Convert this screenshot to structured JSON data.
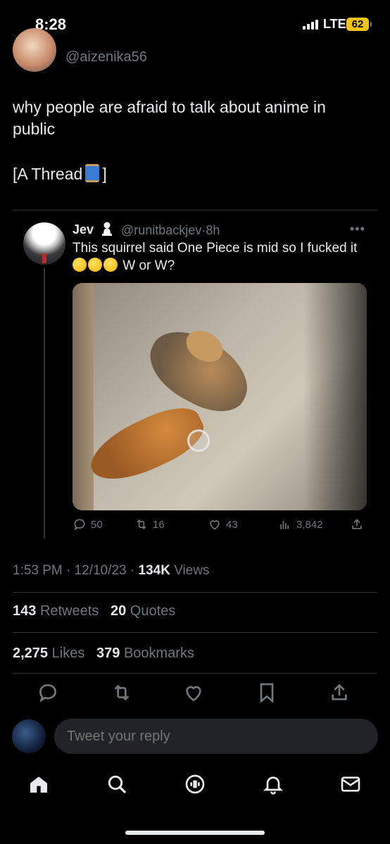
{
  "status_bar": {
    "time": "8:28",
    "network": "LTE",
    "battery": "62",
    "battery_color": "#f2c318"
  },
  "tweet": {
    "author_handle": "@aizenika56",
    "text_line1": "why people are afraid to talk about anime in public",
    "thread_prefix": "[A Thread",
    "thread_suffix": "]",
    "thread_icon": "spool-of-thread-icon"
  },
  "quote": {
    "name": "Jev",
    "badge_icon": "chess-pawn-badge-icon",
    "handle": "@runitbackjev",
    "time": "8h",
    "text_before_emoji": "This squirrel said One Piece is mid so I fucked it",
    "emojis": [
      "loudly-crying-face",
      "loudly-crying-face",
      "rolling-on-floor-laughing"
    ],
    "text_after_emoji": "W or W?",
    "more_label": "•••",
    "media_icon": "squirrel-photo",
    "actions": {
      "replies": "50",
      "retweets": "16",
      "likes": "43",
      "views": "3,842"
    }
  },
  "meta": {
    "time": "1:53 PM",
    "date": "12/10/23",
    "views_count": "134K",
    "views_label": "Views"
  },
  "stats": {
    "retweets_count": "143",
    "retweets_label": "Retweets",
    "quotes_count": "20",
    "quotes_label": "Quotes",
    "likes_count": "2,275",
    "likes_label": "Likes",
    "bookmarks_count": "379",
    "bookmarks_label": "Bookmarks"
  },
  "reply": {
    "placeholder": "Tweet your reply"
  },
  "colors": {
    "background": "#000000",
    "text": "#e7e9ea",
    "muted": "#71767b",
    "divider": "#2f3336"
  }
}
